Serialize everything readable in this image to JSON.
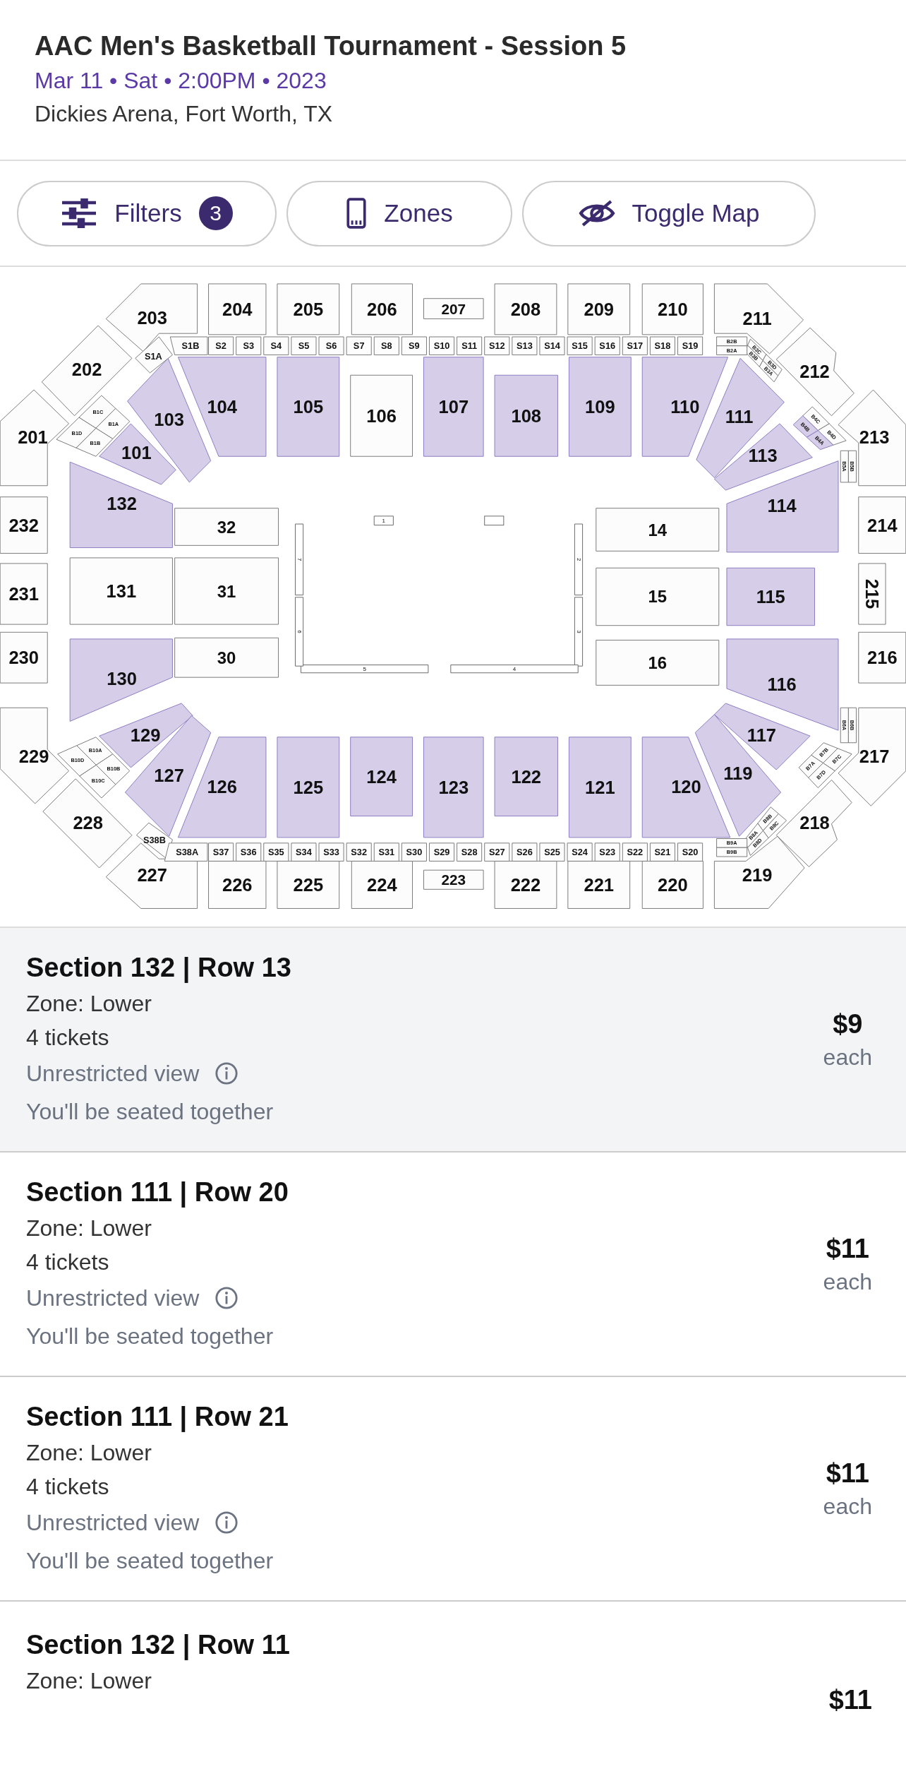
{
  "event": {
    "title": "AAC Men's Basketball Tournament - Session 5",
    "date_line": "Mar 11 • Sat • 2:00PM • 2023",
    "venue": "Dickies Arena, Fort Worth, TX"
  },
  "toolbar": [
    {
      "kind": "filters",
      "label": "Filters",
      "badge": "3"
    },
    {
      "kind": "zones",
      "label": "Zones"
    },
    {
      "kind": "map",
      "label": "Toggle Map"
    }
  ],
  "map": {
    "sections": [
      {
        "label": "203",
        "available": false
      },
      {
        "label": "204",
        "available": false
      },
      {
        "label": "205",
        "available": false
      },
      {
        "label": "206",
        "available": false
      },
      {
        "label": "207",
        "available": false
      },
      {
        "label": "208",
        "available": false
      },
      {
        "label": "209",
        "available": false
      },
      {
        "label": "210",
        "available": false
      },
      {
        "label": "211",
        "available": false
      },
      {
        "label": "202",
        "available": false
      },
      {
        "label": "212",
        "available": false
      },
      {
        "label": "201",
        "available": false
      },
      {
        "label": "103",
        "available": true
      },
      {
        "label": "104",
        "available": true
      },
      {
        "label": "105",
        "available": true
      },
      {
        "label": "106",
        "available": false
      },
      {
        "label": "107",
        "available": true
      },
      {
        "label": "108",
        "available": true
      },
      {
        "label": "109",
        "available": true
      },
      {
        "label": "110",
        "available": true
      },
      {
        "label": "111",
        "available": true
      },
      {
        "label": "213",
        "available": false
      },
      {
        "label": "101",
        "available": true
      },
      {
        "label": "113",
        "available": true
      },
      {
        "label": "132",
        "available": true
      },
      {
        "label": "114",
        "available": true
      },
      {
        "label": "232",
        "available": false
      },
      {
        "label": "32",
        "available": false
      },
      {
        "label": "14",
        "available": false
      },
      {
        "label": "214",
        "available": false
      },
      {
        "label": "231",
        "available": false
      },
      {
        "label": "131",
        "available": false
      },
      {
        "label": "31",
        "available": false
      },
      {
        "label": "15",
        "available": false
      },
      {
        "label": "115",
        "available": true
      },
      {
        "label": "215",
        "available": false
      },
      {
        "label": "230",
        "available": false
      },
      {
        "label": "130",
        "available": true
      },
      {
        "label": "30",
        "available": false
      },
      {
        "label": "16",
        "available": false
      },
      {
        "label": "116",
        "available": true
      },
      {
        "label": "216",
        "available": false
      },
      {
        "label": "229",
        "available": false
      },
      {
        "label": "129",
        "available": true
      },
      {
        "label": "117",
        "available": true
      },
      {
        "label": "217",
        "available": false
      },
      {
        "label": "127",
        "available": true
      },
      {
        "label": "126",
        "available": true
      },
      {
        "label": "125",
        "available": true
      },
      {
        "label": "124",
        "available": true
      },
      {
        "label": "123",
        "available": true
      },
      {
        "label": "122",
        "available": true
      },
      {
        "label": "121",
        "available": true
      },
      {
        "label": "120",
        "available": true
      },
      {
        "label": "119",
        "available": true
      },
      {
        "label": "228",
        "available": false
      },
      {
        "label": "218",
        "available": false
      },
      {
        "label": "227",
        "available": false
      },
      {
        "label": "226",
        "available": false
      },
      {
        "label": "225",
        "available": false
      },
      {
        "label": "224",
        "available": false
      },
      {
        "label": "223",
        "available": false
      },
      {
        "label": "222",
        "available": false
      },
      {
        "label": "221",
        "available": false
      },
      {
        "label": "220",
        "available": false
      },
      {
        "label": "219",
        "available": false
      }
    ],
    "suites_top": [
      {
        "label": "S1A",
        "available": false
      },
      {
        "label": "S1B",
        "available": false
      },
      {
        "label": "S2",
        "available": false
      },
      {
        "label": "S3",
        "available": false
      },
      {
        "label": "S4",
        "available": false
      },
      {
        "label": "S5",
        "available": false
      },
      {
        "label": "S6",
        "available": false
      },
      {
        "label": "S7",
        "available": false
      },
      {
        "label": "S8",
        "available": false
      },
      {
        "label": "S9",
        "available": false
      },
      {
        "label": "S10",
        "available": false
      },
      {
        "label": "S11",
        "available": false
      },
      {
        "label": "S12",
        "available": false
      },
      {
        "label": "S13",
        "available": false
      },
      {
        "label": "S14",
        "available": false
      },
      {
        "label": "S15",
        "available": false
      },
      {
        "label": "S16",
        "available": false
      },
      {
        "label": "S17",
        "available": false
      },
      {
        "label": "S18",
        "available": false
      },
      {
        "label": "S19",
        "available": false
      }
    ],
    "suites_bottom": [
      {
        "label": "S38B",
        "available": false
      },
      {
        "label": "S38A",
        "available": false
      },
      {
        "label": "S37",
        "available": false
      },
      {
        "label": "S36",
        "available": false
      },
      {
        "label": "S35",
        "available": false
      },
      {
        "label": "S34",
        "available": false
      },
      {
        "label": "S33",
        "available": false
      },
      {
        "label": "S32",
        "available": false
      },
      {
        "label": "S31",
        "available": false
      },
      {
        "label": "S30",
        "available": false
      },
      {
        "label": "S29",
        "available": false
      },
      {
        "label": "S28",
        "available": false
      },
      {
        "label": "S27",
        "available": false
      },
      {
        "label": "S26",
        "available": false
      },
      {
        "label": "S25",
        "available": false
      },
      {
        "label": "S24",
        "available": false
      },
      {
        "label": "S23",
        "available": false
      },
      {
        "label": "S22",
        "available": false
      },
      {
        "label": "S21",
        "available": false
      },
      {
        "label": "S20",
        "available": false
      }
    ],
    "box_groups": [
      {
        "boxes": [
          {
            "label": "B1C",
            "available": false
          },
          {
            "label": "B1A",
            "available": false
          },
          {
            "label": "B1B",
            "available": false
          },
          {
            "label": "B1D",
            "available": false
          }
        ]
      },
      {
        "boxes": [
          {
            "label": "B3C",
            "available": false
          },
          {
            "label": "B3D",
            "available": false
          },
          {
            "label": "B3A",
            "available": false
          },
          {
            "label": "B3B",
            "available": false
          }
        ]
      },
      {
        "boxes": [
          {
            "label": "B4C",
            "available": false
          },
          {
            "label": "B4D",
            "available": false
          },
          {
            "label": "B4A",
            "available": true
          },
          {
            "label": "B4B",
            "available": true
          }
        ]
      },
      {
        "boxes": [
          {
            "label": "B7B",
            "available": false
          },
          {
            "label": "B7C",
            "available": false
          },
          {
            "label": "B7D",
            "available": false
          },
          {
            "label": "B7A",
            "available": false
          }
        ]
      },
      {
        "boxes": [
          {
            "label": "B8B",
            "available": false
          },
          {
            "label": "B8C",
            "available": false
          },
          {
            "label": "B8D",
            "available": false
          },
          {
            "label": "B8A",
            "available": false
          }
        ]
      },
      {
        "boxes": [
          {
            "label": "B10A",
            "available": false
          },
          {
            "label": "B10B",
            "available": false
          },
          {
            "label": "B10C",
            "available": false
          },
          {
            "label": "B10D",
            "available": false
          }
        ]
      }
    ],
    "box_pairs": [
      {
        "boxes": [
          {
            "label": "B2B",
            "available": false
          },
          {
            "label": "B2A",
            "available": false
          }
        ]
      },
      {
        "boxes": [
          {
            "label": "B9A",
            "available": false
          },
          {
            "label": "B9B",
            "available": false
          }
        ]
      },
      {
        "boxes": [
          {
            "label": "B5A",
            "available": false
          },
          {
            "label": "B5B",
            "available": false
          }
        ]
      },
      {
        "boxes": [
          {
            "label": "B6A",
            "available": false
          },
          {
            "label": "B6B",
            "available": false
          }
        ]
      }
    ],
    "court_markers": [
      "1",
      "2",
      "3",
      "4",
      "5",
      "6",
      "7"
    ]
  },
  "listings": [
    {
      "title": "Section 132 | Row 13",
      "zone": "Zone: Lower",
      "tickets": "4 tickets",
      "view": "Unrestricted view",
      "seating": "You'll be seated together",
      "price": "$9",
      "unit": "each",
      "selected": true
    },
    {
      "title": "Section 111 | Row 20",
      "zone": "Zone: Lower",
      "tickets": "4 tickets",
      "view": "Unrestricted view",
      "seating": "You'll be seated together",
      "price": "$11",
      "unit": "each",
      "selected": false
    },
    {
      "title": "Section 111 | Row 21",
      "zone": "Zone: Lower",
      "tickets": "4 tickets",
      "view": "Unrestricted view",
      "seating": "You'll be seated together",
      "price": "$11",
      "unit": "each",
      "selected": false
    },
    {
      "title": "Section 132 | Row 11",
      "zone": "Zone: Lower",
      "price": "$11",
      "selected": false
    }
  ]
}
